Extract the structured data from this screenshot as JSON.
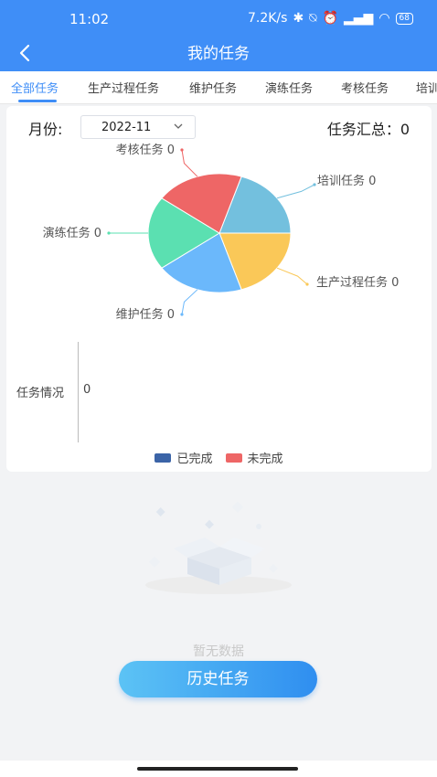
{
  "status_bar": {
    "time": "11:02",
    "speed": "7.2K/s",
    "battery": "68"
  },
  "header": {
    "title": "我的任务",
    "back_icon": "chevron-left-icon",
    "bg_color": "#3f8ef7"
  },
  "tabs": [
    {
      "label": "全部任务",
      "active": true
    },
    {
      "label": "生产过程任务",
      "active": false
    },
    {
      "label": "维护任务",
      "active": false
    },
    {
      "label": "演练任务",
      "active": false
    },
    {
      "label": "考核任务",
      "active": false
    },
    {
      "label": "培训",
      "active": false
    }
  ],
  "filter": {
    "month_label": "月份:",
    "month_value": "2022-11",
    "summary": "任务汇总：0"
  },
  "chart_data": [
    {
      "type": "pie",
      "series": [
        {
          "name": "培训任务",
          "value": 0,
          "color": "#73c0de"
        },
        {
          "name": "生产过程任务",
          "value": 0,
          "color": "#fac858"
        },
        {
          "name": "维护任务",
          "value": 0,
          "color": "#6bb8fb"
        },
        {
          "name": "演练任务",
          "value": 0,
          "color": "#5be0b1"
        },
        {
          "name": "考核任务",
          "value": 0,
          "color": "#ee6666"
        }
      ],
      "labels": [
        "培训任务 0",
        "生产过程任务 0",
        "维护任务 0",
        "演练任务 0",
        "考核任务 0"
      ]
    },
    {
      "type": "bar",
      "categories": [
        "任务情况"
      ],
      "series": [
        {
          "name": "已完成",
          "values": [
            0
          ],
          "color": "#3b64a7"
        },
        {
          "name": "未完成",
          "values": [
            0
          ],
          "color": "#ee6666"
        }
      ],
      "ytick": "0"
    }
  ],
  "empty_state": {
    "text": "暂无数据",
    "icon": "empty-box-icon"
  },
  "actions": {
    "history_label": "历史任务"
  }
}
